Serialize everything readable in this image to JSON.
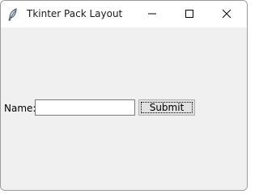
{
  "window": {
    "title": "Tkinter Pack Layout",
    "controls": {
      "minimize_icon": "minimize-icon",
      "maximize_icon": "maximize-icon",
      "close_icon": "close-icon"
    },
    "app_icon": "feather-icon"
  },
  "form": {
    "name_label": "Name:",
    "name_value": "",
    "submit_label": "Submit"
  },
  "colors": {
    "window_background": "#f0f0f0",
    "titlebar_background": "#ffffff",
    "button_background": "#e1e1e1"
  }
}
